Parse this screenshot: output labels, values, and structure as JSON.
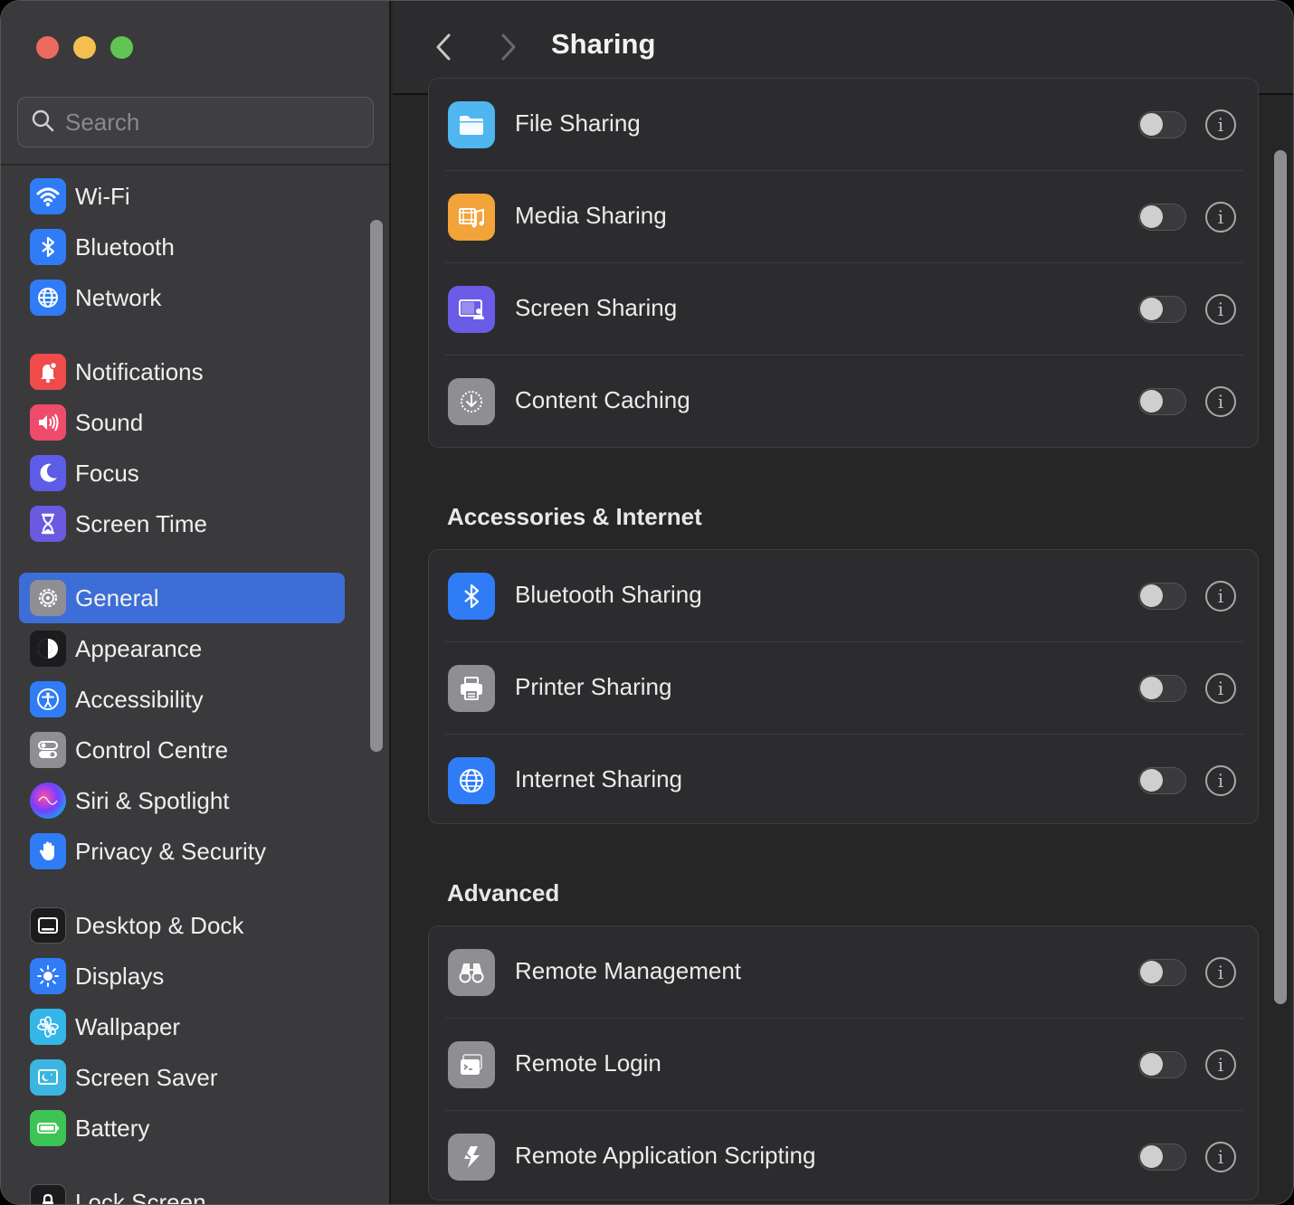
{
  "window": {
    "traffic_lights": [
      "close",
      "minimize",
      "zoom"
    ]
  },
  "sidebar": {
    "search_placeholder": "Search",
    "items": [
      {
        "label": "Wi-Fi",
        "icon": "wifi-icon",
        "color": "#2f7cf6"
      },
      {
        "label": "Bluetooth",
        "icon": "bluetooth-icon",
        "color": "#2f7cf6"
      },
      {
        "label": "Network",
        "icon": "globe-icon",
        "color": "#2f7cf6"
      },
      {
        "label": "Notifications",
        "icon": "bell-icon",
        "color": "#ef4b4b"
      },
      {
        "label": "Sound",
        "icon": "speaker-icon",
        "color": "#ef4b6a"
      },
      {
        "label": "Focus",
        "icon": "moon-icon",
        "color": "#5d5ce6"
      },
      {
        "label": "Screen Time",
        "icon": "hourglass-icon",
        "color": "#6a5ae0"
      },
      {
        "label": "General",
        "icon": "gear-icon",
        "color": "#8e8e93",
        "selected": true
      },
      {
        "label": "Appearance",
        "icon": "appearance-icon",
        "color": "#1c1c1e"
      },
      {
        "label": "Accessibility",
        "icon": "accessibility-icon",
        "color": "#2f7cf6"
      },
      {
        "label": "Control Centre",
        "icon": "switches-icon",
        "color": "#8e8e93"
      },
      {
        "label": "Siri & Spotlight",
        "icon": "siri-icon",
        "color": "#7a3cff"
      },
      {
        "label": "Privacy & Security",
        "icon": "hand-icon",
        "color": "#2f7cf6"
      },
      {
        "label": "Desktop & Dock",
        "icon": "dock-icon",
        "color": "#1c1c1e"
      },
      {
        "label": "Displays",
        "icon": "sun-icon",
        "color": "#2f7cf6"
      },
      {
        "label": "Wallpaper",
        "icon": "flower-icon",
        "color": "#35b6e8"
      },
      {
        "label": "Screen Saver",
        "icon": "screensaver-icon",
        "color": "#3ab6e0"
      },
      {
        "label": "Battery",
        "icon": "battery-icon",
        "color": "#3cc554"
      },
      {
        "label": "Lock Screen",
        "icon": "lock-icon",
        "color": "#1c1c1e"
      }
    ]
  },
  "toolbar": {
    "title": "Sharing"
  },
  "groups": [
    {
      "title": "",
      "rows": [
        {
          "label": "File Sharing",
          "icon": "folder-icon",
          "color": "#4fb6f0",
          "enabled": false
        },
        {
          "label": "Media Sharing",
          "icon": "music-icon",
          "color": "#f2a33a",
          "enabled": false
        },
        {
          "label": "Screen Sharing",
          "icon": "screen-sharing-icon",
          "color": "#6b5ce7",
          "enabled": false
        },
        {
          "label": "Content Caching",
          "icon": "download-icon",
          "color": "#8e8e93",
          "enabled": false
        }
      ]
    },
    {
      "title": "Accessories & Internet",
      "rows": [
        {
          "label": "Bluetooth Sharing",
          "icon": "bluetooth-icon",
          "color": "#2f7cf6",
          "enabled": false
        },
        {
          "label": "Printer Sharing",
          "icon": "printer-icon",
          "color": "#8e8e93",
          "enabled": false
        },
        {
          "label": "Internet Sharing",
          "icon": "globe-icon",
          "color": "#2f7cf6",
          "enabled": false
        }
      ]
    },
    {
      "title": "Advanced",
      "rows": [
        {
          "label": "Remote Management",
          "icon": "binoculars-icon",
          "color": "#8e8e93",
          "enabled": false
        },
        {
          "label": "Remote Login",
          "icon": "terminal-icon",
          "color": "#8e8e93",
          "enabled": false
        },
        {
          "label": "Remote Application Scripting",
          "icon": "script-icon",
          "color": "#8e8e93",
          "enabled": false
        }
      ]
    }
  ]
}
